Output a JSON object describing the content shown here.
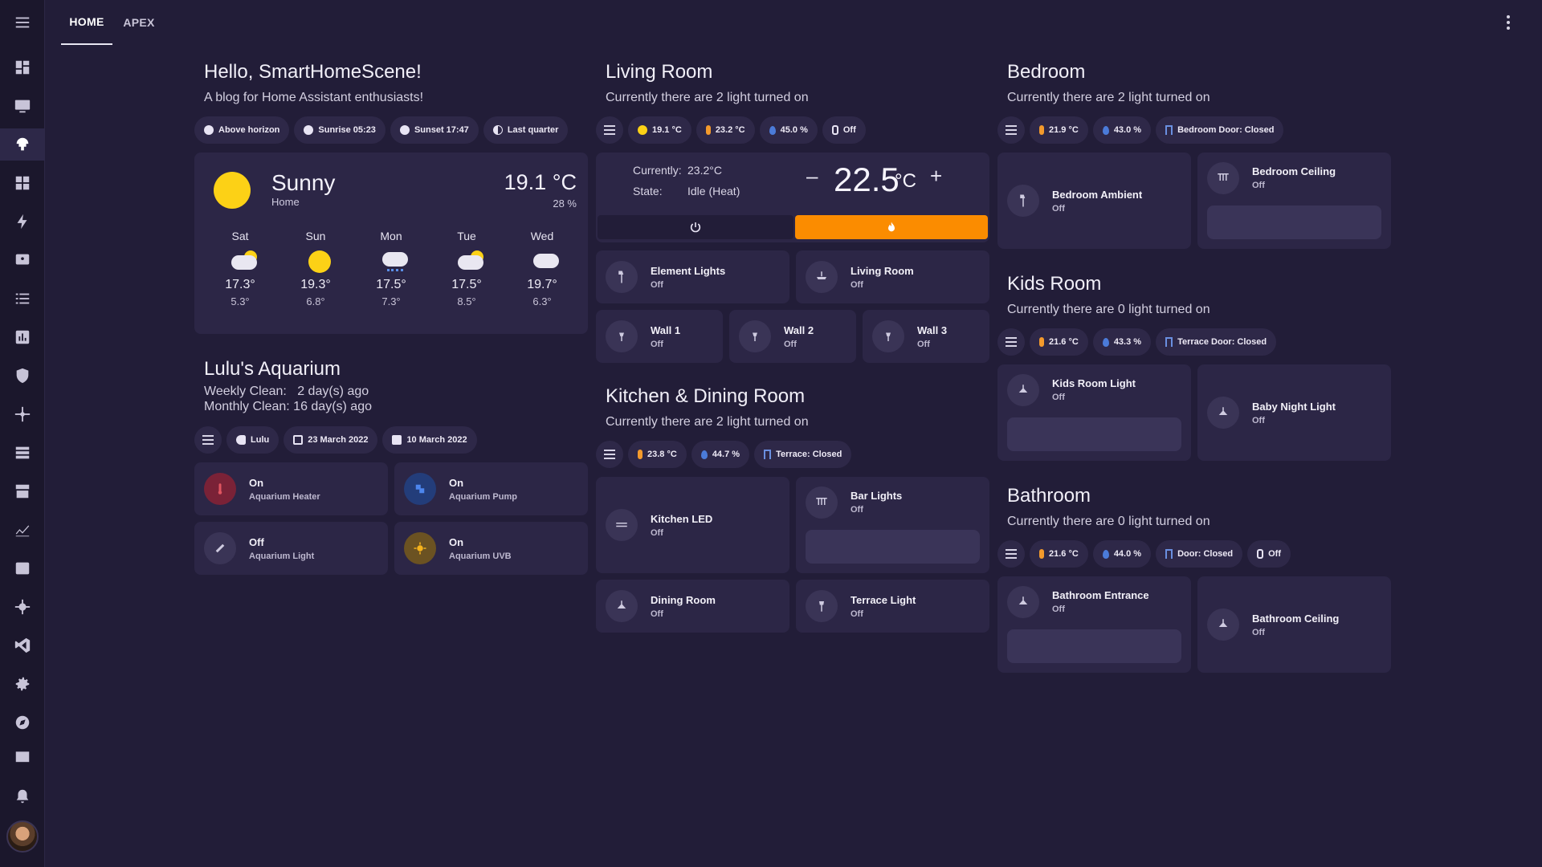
{
  "tabs": [
    "HOME",
    "APEX"
  ],
  "greeting": {
    "title": "Hello, SmartHomeScene!",
    "subtitle": "A blog for Home Assistant enthusiasts!",
    "chips": [
      "Above horizon",
      "Sunrise 05:23",
      "Sunset 17:47",
      "Last quarter"
    ]
  },
  "weather": {
    "condition": "Sunny",
    "location": "Home",
    "temperature": "19.1 °C",
    "humidity": "28 %",
    "forecast": [
      {
        "day": "Sat",
        "icon": "partly-cloudy-icon",
        "high": "17.3°",
        "low": "5.3°"
      },
      {
        "day": "Sun",
        "icon": "sunny-icon",
        "high": "19.3°",
        "low": "6.8°"
      },
      {
        "day": "Mon",
        "icon": "rainy-icon",
        "high": "17.5°",
        "low": "7.3°"
      },
      {
        "day": "Tue",
        "icon": "partly-cloudy-icon",
        "high": "17.5°",
        "low": "8.5°"
      },
      {
        "day": "Wed",
        "icon": "cloudy-icon",
        "high": "19.7°",
        "low": "6.3°"
      }
    ]
  },
  "aquarium": {
    "title": "Lulu's Aquarium",
    "weekly": "Weekly Clean:   2 day(s) ago",
    "monthly": "Monthly Clean: 16 day(s) ago",
    "chips": [
      "Lulu",
      "23 March 2022",
      "10 March 2022"
    ],
    "tiles": [
      {
        "state": "On",
        "name": "Aquarium Heater",
        "color": "#c0394b"
      },
      {
        "state": "On",
        "name": "Aquarium Pump",
        "color": "#3b6fd6"
      },
      {
        "state": "Off",
        "name": "Aquarium Light",
        "color": "#3a3456"
      },
      {
        "state": "On",
        "name": "Aquarium UVB",
        "color": "#f5b21c"
      }
    ]
  },
  "living": {
    "title": "Living Room",
    "subtitle": "Currently there are 2 light turned on",
    "chips": [
      "19.1 °C",
      "23.2 °C",
      "45.0 %",
      "Off"
    ],
    "thermostat": {
      "currently_label": "Currently:",
      "currently": "23.2°C",
      "state_label": "State:",
      "state": "Idle (Heat)",
      "setpoint": "22.5",
      "unit": "°C",
      "minus": "–",
      "plus": "+",
      "heat_color": "#fb8c00"
    },
    "tiles": [
      {
        "name": "Element Lights",
        "state": "Off"
      },
      {
        "name": "Living Room",
        "state": "Off"
      },
      {
        "name": "Wall 1",
        "state": "Off"
      },
      {
        "name": "Wall 2",
        "state": "Off"
      },
      {
        "name": "Wall 3",
        "state": "Off"
      }
    ]
  },
  "kitchen": {
    "title": "Kitchen & Dining Room",
    "subtitle": "Currently there are 2 light turned on",
    "chips": [
      "23.8 °C",
      "44.7 %",
      "Terrace: Closed"
    ],
    "tiles": [
      {
        "name": "Kitchen LED",
        "state": "Off"
      },
      {
        "name": "Bar Lights",
        "state": "Off"
      },
      {
        "name": "Dining Room",
        "state": "Off"
      },
      {
        "name": "Terrace Light",
        "state": "Off"
      }
    ]
  },
  "bedroom": {
    "title": "Bedroom",
    "subtitle": "Currently there are 2 light turned on",
    "chips": [
      "21.9 °C",
      "43.0 %",
      "Bedroom Door: Closed"
    ],
    "tiles": [
      {
        "name": "Bedroom Ambient",
        "state": "Off"
      },
      {
        "name": "Bedroom Ceiling",
        "state": "Off"
      }
    ]
  },
  "kids": {
    "title": "Kids Room",
    "subtitle": "Currently there are 0 light turned on",
    "chips": [
      "21.6 °C",
      "43.3 %",
      "Terrace Door: Closed"
    ],
    "tiles": [
      {
        "name": "Kids Room Light",
        "state": "Off"
      },
      {
        "name": "Baby Night Light",
        "state": "Off"
      }
    ]
  },
  "bathroom": {
    "title": "Bathroom",
    "subtitle": "Currently there are 0 light turned on",
    "chips": [
      "21.6 °C",
      "44.0 %",
      "Door: Closed",
      "Off"
    ],
    "tiles": [
      {
        "name": "Bathroom Entrance",
        "state": "Off"
      },
      {
        "name": "Bathroom Ceiling",
        "state": "Off"
      }
    ]
  }
}
